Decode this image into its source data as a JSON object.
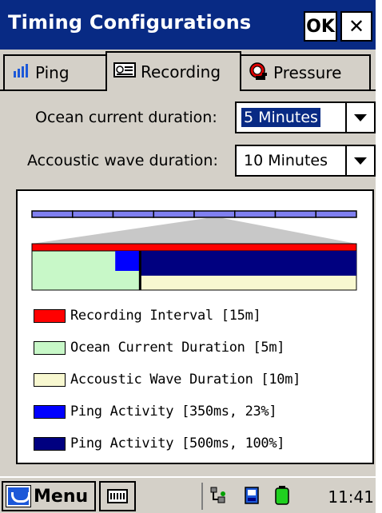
{
  "window": {
    "title": "Timing Configurations",
    "ok_label": "OK",
    "close_label": "✕"
  },
  "tabs": [
    {
      "label": "Ping",
      "icon": "signal-bars-icon",
      "selected": false
    },
    {
      "label": "Recording",
      "icon": "recorder-icon",
      "selected": true
    },
    {
      "label": "Pressure",
      "icon": "pressure-gauge-icon",
      "selected": false
    }
  ],
  "form": {
    "ocean_label": "Ocean current duration:",
    "ocean_value": "5 Minutes",
    "acoustic_label": "Accoustic wave duration:",
    "acoustic_value": "10 Minutes"
  },
  "diagram": {
    "timeline_segments": 8,
    "recording_interval_min": 15,
    "ocean_current_min": 5,
    "acoustic_wave_min": 10,
    "ping_activity_fraction": 0.23,
    "colors": {
      "timeline": "#8080f0",
      "recording": "#ff0000",
      "ocean": "#c8f8c8",
      "acoustic": "#f8f8d0",
      "ping_partial": "#0000ff",
      "ping_full": "#000080",
      "zoom": "#c8c8c8"
    }
  },
  "legend": [
    {
      "label": "Recording Interval [15m]",
      "color": "#ff0000"
    },
    {
      "label": "Ocean Current Duration [5m]",
      "color": "#c8f8c8"
    },
    {
      "label": "Accoustic Wave Duration [10m]",
      "color": "#f8f8d0"
    },
    {
      "label": "Ping Activity [350ms, 23%]",
      "color": "#0000ff"
    },
    {
      "label": "Ping Activity [500ms, 100%]",
      "color": "#000080"
    }
  ],
  "taskbar": {
    "start_label": "Menu",
    "clock": "11:41",
    "tray_icons": [
      "network-icon",
      "storage-card-icon",
      "battery-icon"
    ]
  }
}
